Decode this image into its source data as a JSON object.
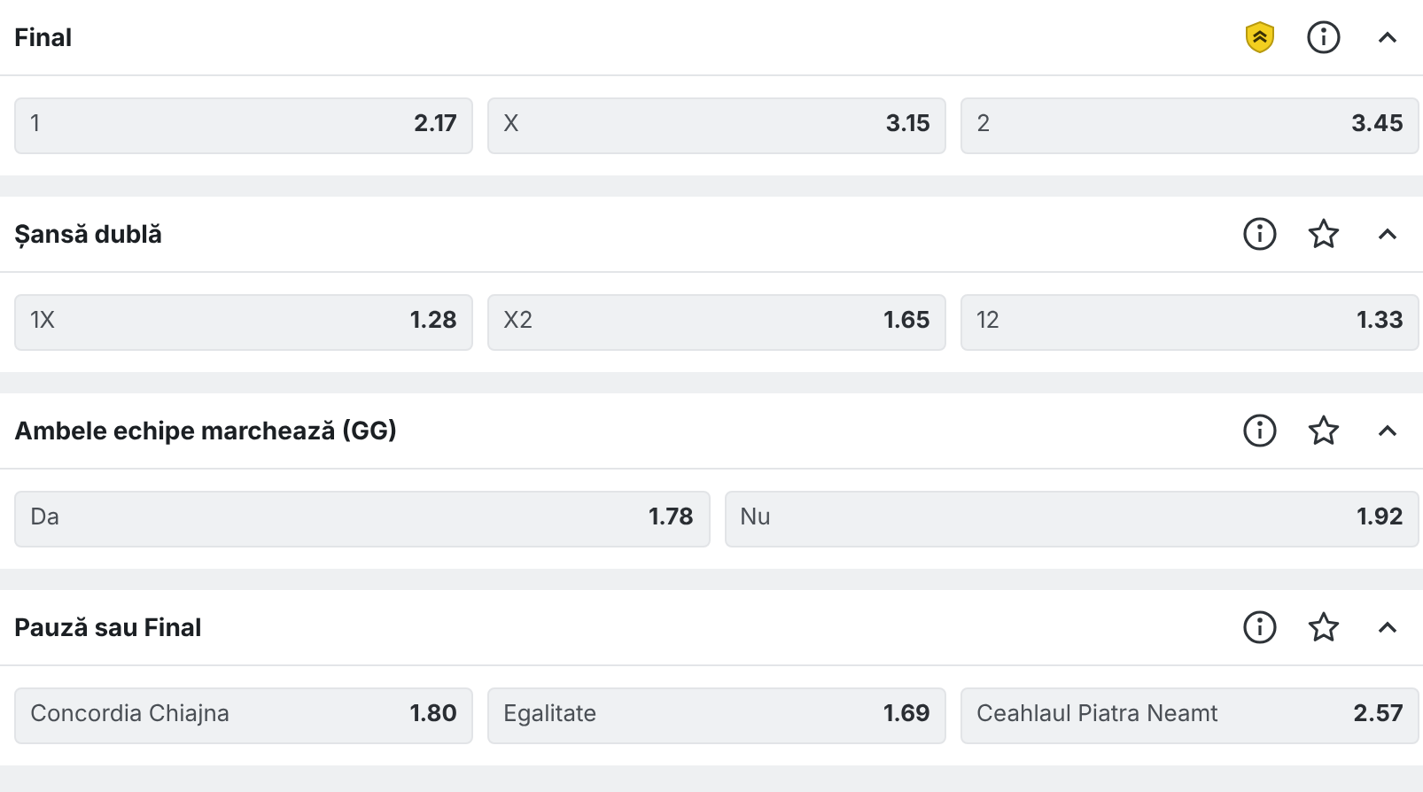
{
  "markets": [
    {
      "title": "Final",
      "kind": "boosted",
      "expanded": true,
      "odds": [
        {
          "label": "1",
          "value": "2.17"
        },
        {
          "label": "X",
          "value": "3.15"
        },
        {
          "label": "2",
          "value": "3.45"
        }
      ]
    },
    {
      "title": "Șansă dublă",
      "kind": "standard",
      "expanded": true,
      "odds": [
        {
          "label": "1X",
          "value": "1.28"
        },
        {
          "label": "X2",
          "value": "1.65"
        },
        {
          "label": "12",
          "value": "1.33"
        }
      ]
    },
    {
      "title": "Ambele echipe marchează (GG)",
      "kind": "standard",
      "expanded": true,
      "odds": [
        {
          "label": "Da",
          "value": "1.78"
        },
        {
          "label": "Nu",
          "value": "1.92"
        }
      ]
    },
    {
      "title": "Pauză sau Final",
      "kind": "standard",
      "expanded": true,
      "odds": [
        {
          "label": "Concordia Chiajna",
          "value": "1.80"
        },
        {
          "label": "Egalitate",
          "value": "1.69"
        },
        {
          "label": "Ceahlaul Piatra Neamt",
          "value": "2.57"
        }
      ]
    }
  ]
}
